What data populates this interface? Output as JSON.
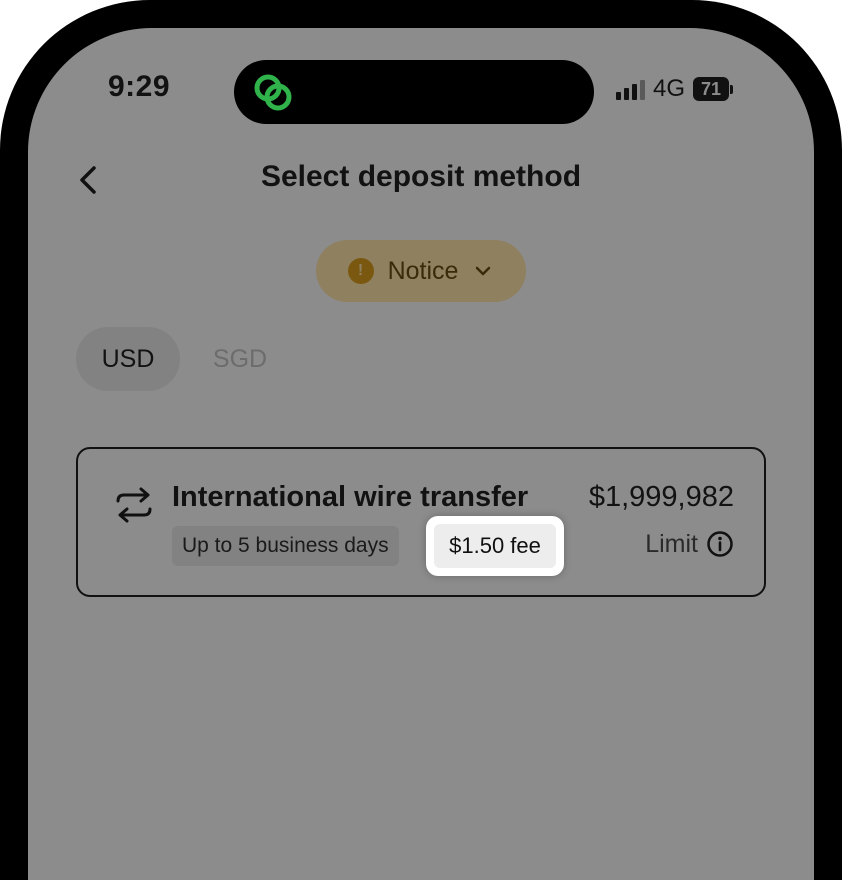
{
  "status_bar": {
    "time": "9:29",
    "network": "4G",
    "battery": "71",
    "island_app_icon": "linked-rings-icon",
    "island_icon_color": "#2fb34a"
  },
  "header": {
    "back_icon": "chevron-left-icon",
    "title": "Select deposit method"
  },
  "notice": {
    "label": "Notice",
    "icon": "exclamation-icon",
    "icon_glyph": "!",
    "chevron": "chevron-down-icon",
    "color": "#c79a2e"
  },
  "tabs": [
    {
      "label": "USD",
      "selected": true
    },
    {
      "label": "SGD",
      "selected": false
    }
  ],
  "methods": [
    {
      "icon": "transfer-arrows-icon",
      "title": "International wire transfer",
      "amount": "$1,999,982",
      "duration": "Up to 5 business days",
      "fee": "$1.50 fee",
      "limit_label": "Limit",
      "limit_icon": "info-icon"
    }
  ]
}
